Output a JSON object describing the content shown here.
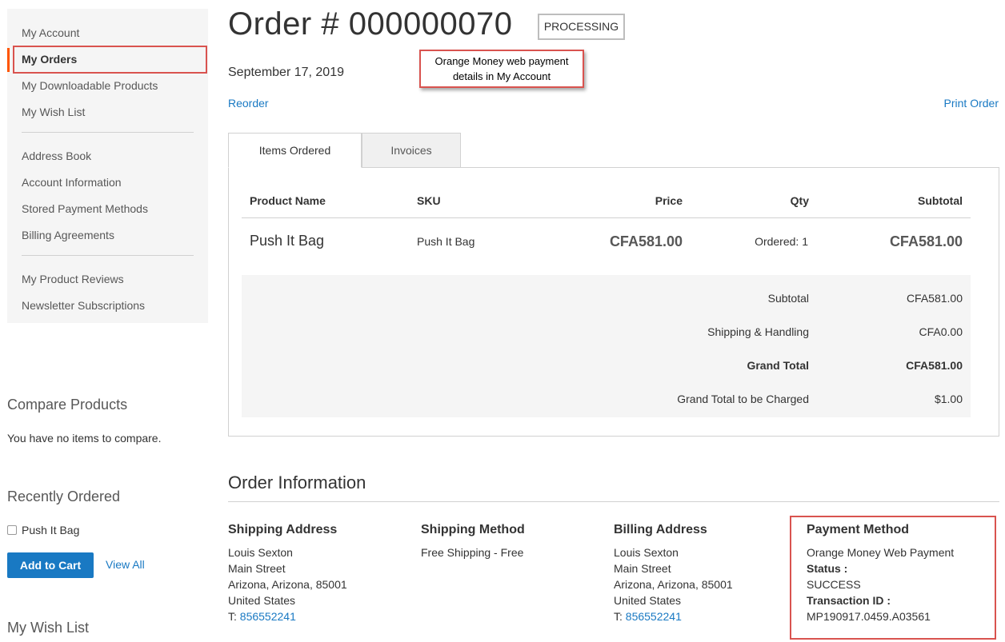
{
  "sidebar": {
    "items_group1": [
      "My Account",
      "My Orders",
      "My Downloadable Products",
      "My Wish List"
    ],
    "items_group2": [
      "Address Book",
      "Account Information",
      "Stored Payment Methods",
      "Billing Agreements"
    ],
    "items_group3": [
      "My Product Reviews",
      "Newsletter Subscriptions"
    ],
    "active_item": "My Orders"
  },
  "compare": {
    "title": "Compare Products",
    "empty_text": "You have no items to compare."
  },
  "recent": {
    "title": "Recently Ordered",
    "item": "Push It Bag",
    "add_to_cart": "Add to Cart",
    "view_all": "View All"
  },
  "wishlist": {
    "title": "My Wish List"
  },
  "order": {
    "title": "Order # 000000070",
    "status": "PROCESSING",
    "date": "September 17, 2019",
    "reorder": "Reorder",
    "print": "Print Order"
  },
  "callout": {
    "line1": "Orange Money web payment",
    "line2": "details in My Account"
  },
  "tabs": [
    "Items Ordered",
    "Invoices"
  ],
  "table": {
    "headers": {
      "name": "Product Name",
      "sku": "SKU",
      "price": "Price",
      "qty": "Qty",
      "subtotal": "Subtotal"
    },
    "row": {
      "name": "Push It Bag",
      "sku": "Push It Bag",
      "price": "CFA581.00",
      "qty": "Ordered: 1",
      "subtotal": "CFA581.00"
    }
  },
  "totals": [
    {
      "label": "Subtotal",
      "value": "CFA581.00"
    },
    {
      "label": "Shipping & Handling",
      "value": "CFA0.00"
    },
    {
      "label": "Grand Total",
      "value": "CFA581.00"
    },
    {
      "label": "Grand Total to be Charged",
      "value": "$1.00"
    }
  ],
  "info": {
    "title": "Order Information",
    "shipping_address": {
      "heading": "Shipping Address",
      "name": "Louis Sexton",
      "street": "Main Street",
      "city": "Arizona, Arizona, 85001",
      "country": "United States",
      "phone_prefix": "T: ",
      "phone": "856552241"
    },
    "shipping_method": {
      "heading": "Shipping Method",
      "value": "Free Shipping - Free"
    },
    "billing_address": {
      "heading": "Billing Address",
      "name": "Louis Sexton",
      "street": "Main Street",
      "city": "Arizona, Arizona, 85001",
      "country": "United States",
      "phone_prefix": "T: ",
      "phone": "856552241"
    },
    "payment": {
      "heading": "Payment Method",
      "method": "Orange Money Web Payment",
      "status_label": "Status :",
      "status": "SUCCESS",
      "txn_label": "Transaction ID :",
      "txn": "MP190917.0459.A03561"
    }
  },
  "colors": {
    "accent": "#1979c3",
    "highlight": "#d9534f",
    "active_marker": "#ff5501"
  }
}
